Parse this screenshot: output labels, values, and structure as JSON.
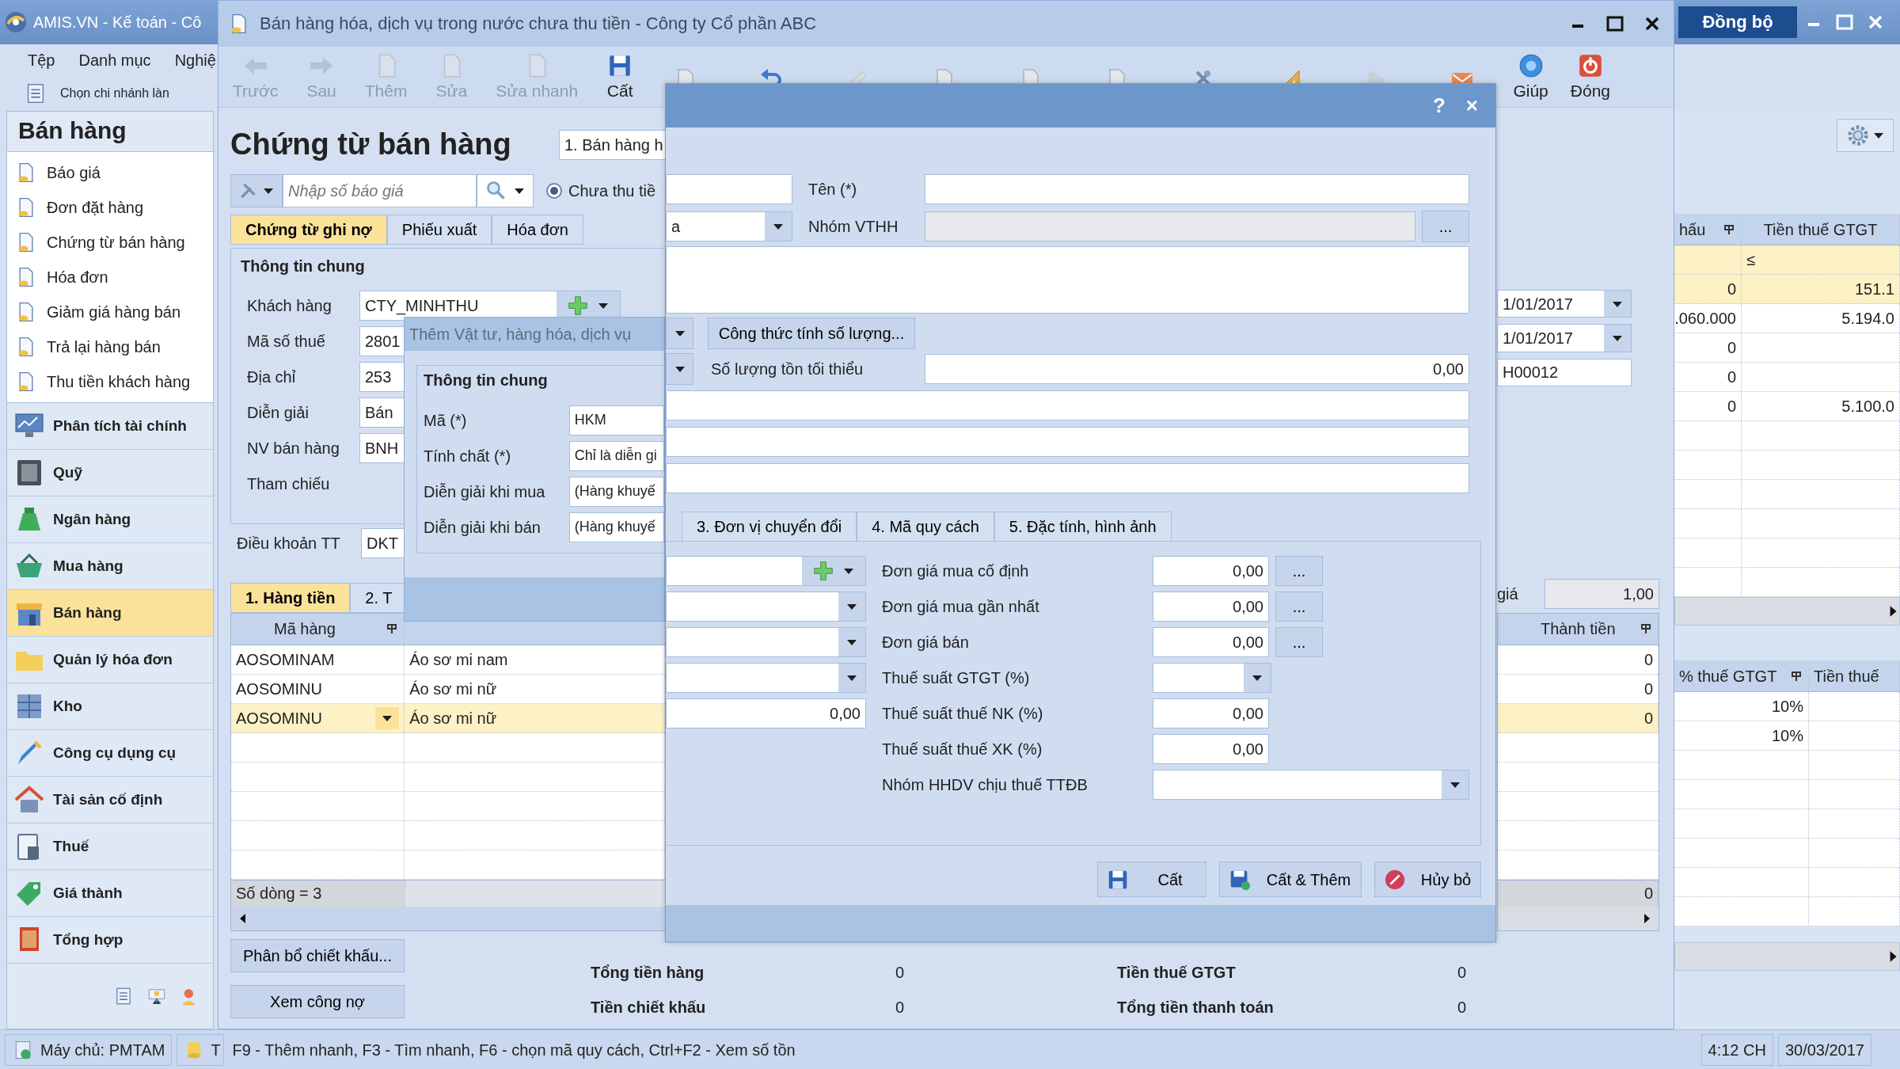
{
  "app": {
    "title": "AMIS.VN - Kế toán - Cô",
    "menu": [
      "Tệp",
      "Danh mục",
      "Nghiệ"
    ],
    "branch_button": "Chọn chi nhánh làn",
    "sync_button": "Đồng bộ",
    "sidebar": {
      "title": "Bán hàng",
      "items": [
        "Báo giá",
        "Đơn đặt hàng",
        "Chứng từ bán hàng",
        "Hóa đơn",
        "Giảm giá hàng bán",
        "Trả lại hàng bán",
        "Thu tiền khách hàng"
      ],
      "modules": [
        {
          "label": "Phân tích tài chính",
          "selected": false
        },
        {
          "label": "Quỹ",
          "selected": false
        },
        {
          "label": "Ngân hàng",
          "selected": false
        },
        {
          "label": "Mua hàng",
          "selected": false
        },
        {
          "label": "Bán hàng",
          "selected": true
        },
        {
          "label": "Quản lý hóa đơn",
          "selected": false
        },
        {
          "label": "Kho",
          "selected": false
        },
        {
          "label": "Công cụ dụng cụ",
          "selected": false
        },
        {
          "label": "Tài sản cố định",
          "selected": false
        },
        {
          "label": "Thuế",
          "selected": false
        },
        {
          "label": "Giá thành",
          "selected": false
        },
        {
          "label": "Tổng hợp",
          "selected": false
        }
      ]
    },
    "list_grid": {
      "columns": [
        "hấu",
        "Tiền thuế GTGT"
      ],
      "filter": "≤",
      "rows": [
        {
          "column_1": "0",
          "column_2": "151.1",
          "selected": true
        },
        {
          "column_1": ".060.000",
          "column_2": "5.194.0",
          "selected": false
        },
        {
          "column_1": "0",
          "selected": false
        },
        {
          "column_1": "0",
          "selected": false
        },
        {
          "column_1": "0",
          "column_2": "5.100.0",
          "selected": false
        }
      ]
    },
    "tax_grid": {
      "columns": [
        "% thuế GTGT",
        "Tiền thuế"
      ],
      "rows": [
        "10%",
        "10%"
      ]
    },
    "status_bar": {
      "server": "Máy chủ: PMTAM",
      "database": "T",
      "hint": "F9 - Thêm nhanh, F3 - Tìm nhanh, F6 - chọn mã quy cách, Ctrl+F2 - Xem số tồn",
      "time": "4:12 CH",
      "date": "30/03/2017"
    }
  },
  "document": {
    "title": "Bán hàng hóa, dịch vụ trong nước chưa thu tiền - Công ty Cổ phần ABC",
    "toolbar": [
      {
        "label": "Trước",
        "disabled": true
      },
      {
        "label": "Sau",
        "disabled": true
      },
      {
        "label": "Thêm",
        "disabled": true
      },
      {
        "label": "Sửa",
        "disabled": true
      },
      {
        "label": "Sửa nhanh",
        "disabled": true
      },
      {
        "label": "Cất",
        "disabled": false
      }
    ],
    "toolbar_right": [
      {
        "label": "Giúp",
        "disabled": false
      },
      {
        "label": "Đóng",
        "disabled": false
      }
    ],
    "heading": "Chứng từ bán hàng",
    "type_combo": "1. Bán hàng h",
    "search": {
      "placeholder": "Nhập số báo giá"
    },
    "payment_option": {
      "label": "Chưa thu tiề",
      "selected": true
    },
    "tabs": [
      {
        "label": "Chứng từ ghi nợ",
        "selected": true
      },
      {
        "label": "Phiếu xuất",
        "selected": false
      },
      {
        "label": "Hóa đơn",
        "selected": false
      }
    ],
    "general": {
      "title": "Thông tin chung",
      "fields": [
        {
          "label": "Khách hàng",
          "value": "CTY_MINHTHU"
        },
        {
          "label": "Mã số thuế",
          "value": "2801"
        },
        {
          "label": "Địa chỉ",
          "value": "253"
        },
        {
          "label": "Diễn giải",
          "value": "Bán"
        },
        {
          "label": "NV bán hàng",
          "value": "BNH"
        },
        {
          "label": "Tham chiếu"
        }
      ]
    },
    "payment_terms": {
      "label": "Điều khoản TT",
      "value": "DKT"
    },
    "dates": [
      "1/01/2017",
      "1/01/2017"
    ],
    "voucher_no": "H00012",
    "rate": {
      "label": "giá",
      "value": "1,00"
    },
    "grid_tabs": [
      {
        "label": "1. Hàng tiền",
        "selected": true
      },
      {
        "label": "2. T",
        "selected": false
      }
    ],
    "grid": {
      "columns": [
        "Mã hàng",
        "Thành tiền"
      ],
      "rows": [
        {
          "code": "AOSOMINAM",
          "name": "Áo sơ mi nam",
          "amount": "0",
          "selected": false
        },
        {
          "code": "AOSOMINU",
          "name": "Áo sơ mi nữ",
          "amount": "0",
          "selected": false
        },
        {
          "code": "AOSOMINU",
          "name": "Áo sơ mi nữ",
          "amount": "0",
          "selected": true
        }
      ],
      "footer": "Số dòng = 3",
      "footer_total": "0"
    },
    "buttons": [
      "Phân bổ chiết khấu...",
      "Xem công nợ"
    ],
    "totals": [
      {
        "label": "Tổng tiền hàng",
        "value": "0"
      },
      {
        "label": "Tiền thuế GTGT",
        "value": "0"
      },
      {
        "label": "Tiền chiết khấu",
        "value": "0"
      },
      {
        "label": "Tổng tiền thanh toán",
        "value": "0"
      }
    ]
  },
  "quick_add_dialog": {
    "title": "Thêm Vật tư, hàng hóa, dịch vụ",
    "group": "Thông tin chung",
    "fields": [
      {
        "label": "Mã (*)",
        "value": "HKM"
      },
      {
        "label": "Tính chất (*)",
        "value": "Chỉ là diễn gi"
      },
      {
        "label": "Diễn giải khi mua",
        "value": "(Hàng khuyế"
      },
      {
        "label": "Diễn giải khi bán",
        "value": "(Hàng khuyế"
      }
    ]
  },
  "item_dialog": {
    "help_button": "?",
    "close_button": "×",
    "name_label": "Tên (*)",
    "group_label": "Nhóm VTHH",
    "group_button": "...",
    "kind_fragment": "a",
    "formula_button": "Công thức tính số lượng...",
    "min_stock": {
      "label": "Số lượng tồn tối thiểu",
      "value": "0,00"
    },
    "tabs": [
      {
        "label": "3. Đơn vị chuyển đổi",
        "selected": false
      },
      {
        "label": "4. Mã quy cách",
        "selected": false
      },
      {
        "label": "5. Đặc tính, hình ảnh",
        "selected": false
      }
    ],
    "left_fields": [
      {
        "kind": "add_combo"
      },
      {
        "kind": "combo"
      },
      {
        "kind": "combo"
      },
      {
        "kind": "combo"
      },
      {
        "kind": "number",
        "value": "0,00"
      }
    ],
    "prices": [
      {
        "label": "Đơn giá mua cố định",
        "value": "0,00",
        "kind": "lookup",
        "button": "..."
      },
      {
        "label": "Đơn giá mua gần nhất",
        "value": "0,00",
        "kind": "lookup",
        "button": "..."
      },
      {
        "label": "Đơn giá bán",
        "value": "0,00",
        "kind": "lookup",
        "button": "..."
      },
      {
        "label": "Thuế suất GTGT (%)",
        "kind": "combo"
      },
      {
        "label": "Thuế suất thuế NK (%)",
        "value": "0,00",
        "kind": "number"
      },
      {
        "label": "Thuế suất thuế XK (%)",
        "value": "0,00",
        "kind": "number"
      },
      {
        "label": "Nhóm HHDV chịu thuế TTĐB",
        "kind": "wide_combo"
      }
    ],
    "buttons": [
      "Cất",
      "Cất & Thêm",
      "Hủy bỏ"
    ]
  }
}
